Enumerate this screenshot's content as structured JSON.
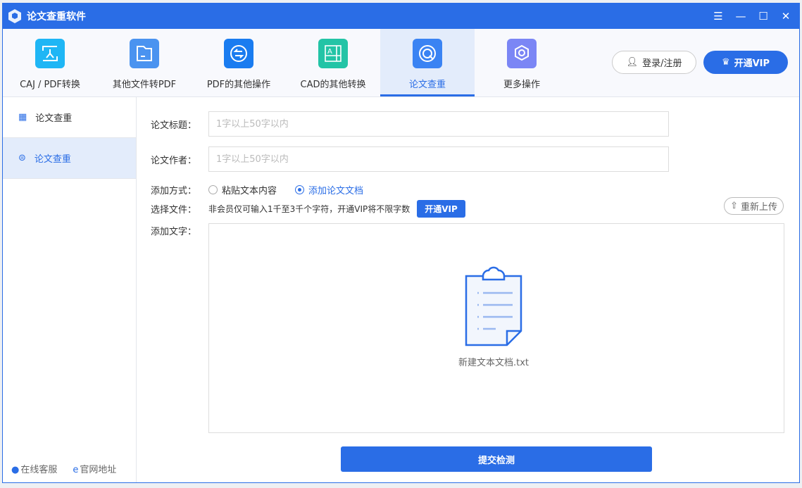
{
  "title": "论文查重软件",
  "tools": [
    {
      "label": "CAJ / PDF转换",
      "icon": "caj-pdf-icon",
      "color": "#1fb6f5"
    },
    {
      "label": "其他文件转PDF",
      "icon": "folder-file-icon",
      "color": "#4a93f0"
    },
    {
      "label": "PDF的其他操作",
      "icon": "swap-arrows-icon",
      "color": "#1a7cf0"
    },
    {
      "label": "CAD的其他转换",
      "icon": "cad-icon",
      "color": "#23c4a6"
    },
    {
      "label": "论文查重",
      "icon": "search-q-icon",
      "color": "#3a83f3"
    },
    {
      "label": "更多操作",
      "icon": "gear-icon",
      "color": "#7b86f5"
    }
  ],
  "account": {
    "login": "登录/注册",
    "vip": "开通VIP"
  },
  "sidebar": {
    "items": [
      {
        "label": "论文查重"
      },
      {
        "label": "论文查重"
      }
    ],
    "service": "在线客服",
    "website": "官网地址"
  },
  "form": {
    "title_label": "论文标题：",
    "title_placeholder": "1字以上50字以内",
    "author_label": "论文作者：",
    "author_placeholder": "1字以上50字以内",
    "method_label": "添加方式：",
    "option_paste": "粘贴文本内容",
    "option_doc": "添加论文文档",
    "file_label": "选择文件：",
    "hint": "非会员仅可输入1千至3千个字符，开通VIP将不限字数",
    "vip_button": "开通VIP",
    "reupload": "重新上传",
    "text_label": "添加文字：",
    "file_name": "新建文本文档.txt",
    "submit": "提交检测"
  }
}
